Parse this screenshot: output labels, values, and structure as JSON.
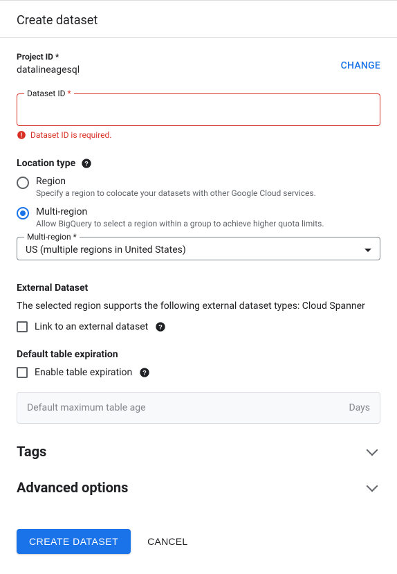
{
  "header": {
    "title": "Create dataset"
  },
  "project": {
    "label": "Project ID *",
    "value": "datalineagesql",
    "change": "CHANGE"
  },
  "dataset_id": {
    "label_text": "Dataset ID",
    "label_req": "*",
    "value": "",
    "error": "Dataset ID is required."
  },
  "location": {
    "heading": "Location type",
    "options": [
      {
        "label": "Region",
        "desc": "Specify a region to colocate your datasets with other Google Cloud services.",
        "selected": false
      },
      {
        "label": "Multi-region",
        "desc": "Allow BigQuery to select a region within a group to achieve higher quota limits.",
        "selected": true
      }
    ],
    "multi_region_label": "Multi-region *",
    "multi_region_value": "US (multiple regions in United States)"
  },
  "external": {
    "heading": "External Dataset",
    "desc": "The selected region supports the following external dataset types: Cloud Spanner",
    "checkbox_label": "Link to an external dataset"
  },
  "expiration": {
    "heading": "Default table expiration",
    "checkbox_label": "Enable table expiration",
    "input_placeholder": "Default maximum table age",
    "unit": "Days"
  },
  "collapsibles": {
    "tags": "Tags",
    "advanced": "Advanced options"
  },
  "buttons": {
    "create": "CREATE DATASET",
    "cancel": "CANCEL"
  }
}
